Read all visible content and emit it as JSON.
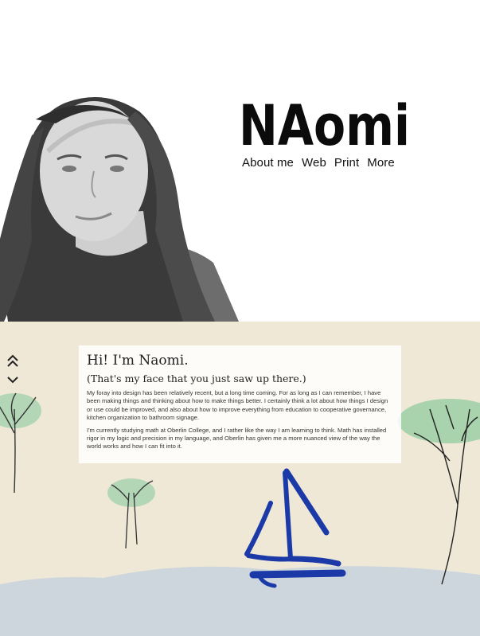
{
  "brand": {
    "logo_text": "NAomi"
  },
  "nav": {
    "items": [
      {
        "label": "About me"
      },
      {
        "label": "Web"
      },
      {
        "label": "Print"
      },
      {
        "label": "More"
      }
    ]
  },
  "about": {
    "heading": "Hi! I'm Naomi.",
    "subheading": "(That's my face that you just saw up there.)",
    "paragraphs": [
      "My foray into design has been relatively recent, but a long time coming. For as long as I can remember, I have been making things and thinking about how to make things better. I certainly think a lot about how things I design or use could be improved, and also about how to improve everything from education to cooperative governance, kitchen organization to bathroom signage.",
      "I'm currently studying math at Oberlin College, and I rather like the way I am learning to think. Math has installed rigor in my logic and precision in my language, and Oberlin has given me a more nuanced view of the way the world works and how I can fit into it."
    ]
  },
  "controls": {
    "up_icon": "double-chevron-up-icon",
    "down_icon": "chevron-down-icon"
  },
  "colors": {
    "paper": "#efe8d6",
    "water": "#cfd6de",
    "tree_green": "#8fc9a0",
    "boat_blue": "#1b3aa8"
  }
}
